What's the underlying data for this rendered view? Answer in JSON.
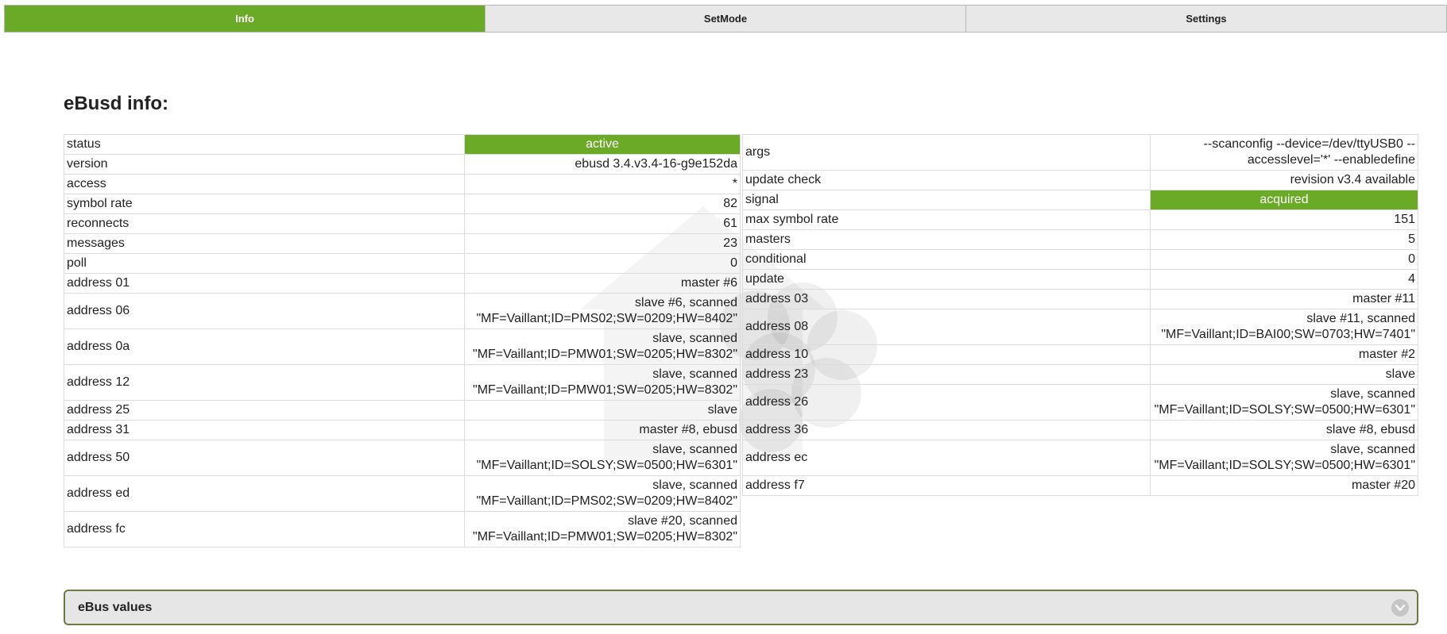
{
  "tabs": [
    {
      "label": "Info",
      "active": true
    },
    {
      "label": "SetMode",
      "active": false
    },
    {
      "label": "Settings",
      "active": false
    }
  ],
  "title": "eBusd info:",
  "left_rows": [
    {
      "key": "status",
      "value": "active",
      "badge": true
    },
    {
      "key": "version",
      "value": "ebusd 3.4.v3.4-16-g9e152da"
    },
    {
      "key": "access",
      "value": "*"
    },
    {
      "key": "symbol rate",
      "value": "82"
    },
    {
      "key": "reconnects",
      "value": "61"
    },
    {
      "key": "messages",
      "value": "23"
    },
    {
      "key": "poll",
      "value": "0"
    },
    {
      "key": "address 01",
      "value": "master #6"
    },
    {
      "key": "address 06",
      "value": "slave #6, scanned \"MF=Vaillant;ID=PMS02;SW=0209;HW=8402\""
    },
    {
      "key": "address 0a",
      "value": "slave, scanned \"MF=Vaillant;ID=PMW01;SW=0205;HW=8302\""
    },
    {
      "key": "address 12",
      "value": "slave, scanned \"MF=Vaillant;ID=PMW01;SW=0205;HW=8302\""
    },
    {
      "key": "address 25",
      "value": "slave"
    },
    {
      "key": "address 31",
      "value": "master #8, ebusd"
    },
    {
      "key": "address 50",
      "value": "slave, scanned \"MF=Vaillant;ID=SOLSY;SW=0500;HW=6301\""
    },
    {
      "key": "address ed",
      "value": "slave, scanned \"MF=Vaillant;ID=PMS02;SW=0209;HW=8402\""
    },
    {
      "key": "address fc",
      "value": "slave #20, scanned \"MF=Vaillant;ID=PMW01;SW=0205;HW=8302\""
    }
  ],
  "right_rows": [
    {
      "key": "args",
      "value": "--scanconfig --device=/dev/ttyUSB0 --accesslevel='*' --enabledefine"
    },
    {
      "key": "update check",
      "value": "revision v3.4 available"
    },
    {
      "key": "signal",
      "value": "acquired",
      "badge": true
    },
    {
      "key": "max symbol rate",
      "value": "151"
    },
    {
      "key": "masters",
      "value": "5"
    },
    {
      "key": "conditional",
      "value": "0"
    },
    {
      "key": "update",
      "value": "4"
    },
    {
      "key": "address 03",
      "value": "master #11"
    },
    {
      "key": "address 08",
      "value": "slave #11, scanned \"MF=Vaillant;ID=BAI00;SW=0703;HW=7401\""
    },
    {
      "key": "address 10",
      "value": "master #2"
    },
    {
      "key": "address 23",
      "value": "slave"
    },
    {
      "key": "address 26",
      "value": "slave, scanned \"MF=Vaillant;ID=SOLSY;SW=0500;HW=6301\""
    },
    {
      "key": "address 36",
      "value": "slave #8, ebusd"
    },
    {
      "key": "address ec",
      "value": "slave, scanned \"MF=Vaillant;ID=SOLSY;SW=0500;HW=6301\""
    },
    {
      "key": "address f7",
      "value": "master #20"
    }
  ],
  "accordion": {
    "label": "eBus values",
    "icon": "chevron-down-icon"
  },
  "colors": {
    "accent": "#6aaa26",
    "accordion_border": "#6b7a3f"
  }
}
